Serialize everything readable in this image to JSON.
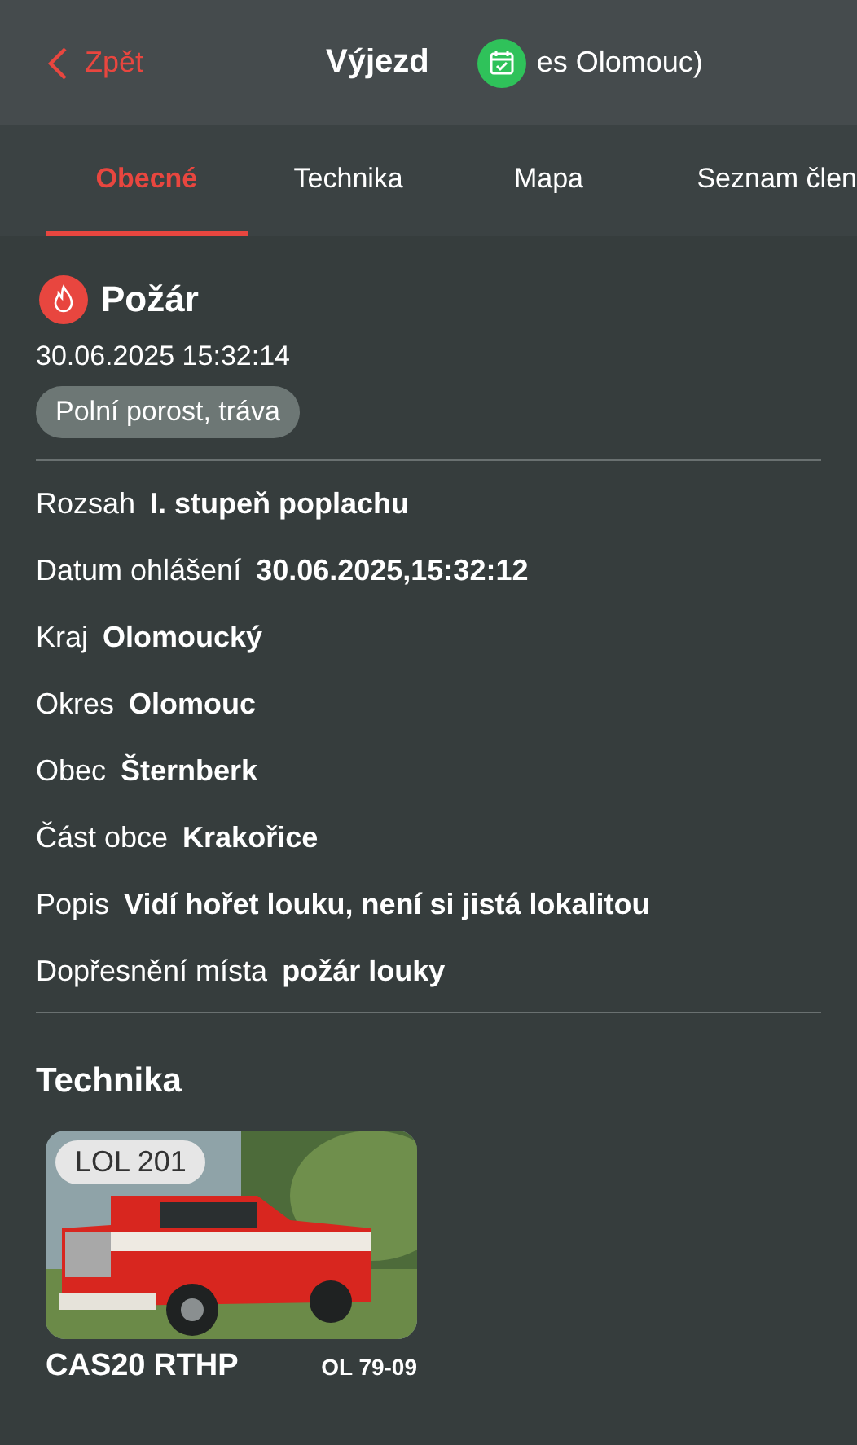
{
  "header": {
    "back": "Zpět",
    "title": "Výjezd",
    "subtitle": "es Olomouc)"
  },
  "tabs": [
    {
      "label": "Obecné",
      "selected": true
    },
    {
      "label": "Technika",
      "selected": false
    },
    {
      "label": "Mapa",
      "selected": false
    },
    {
      "label": "Seznam člen",
      "selected": false
    }
  ],
  "incident": {
    "type": "Požár",
    "datetime": "30.06.2025 15:32:14",
    "tag": "Polní porost, tráva"
  },
  "details": [
    {
      "label": "Rozsah",
      "value": "I. stupeň poplachu"
    },
    {
      "label": "Datum ohlášení",
      "value": "30.06.2025,15:32:12"
    },
    {
      "label": "Kraj",
      "value": "Olomoucký"
    },
    {
      "label": "Okres",
      "value": "Olomouc"
    },
    {
      "label": "Obec",
      "value": "Šternberk"
    },
    {
      "label": "Část obce",
      "value": "Krakořice"
    },
    {
      "label": "Popis",
      "value": "Vidí hořet louku, není si jistá lokalitou"
    },
    {
      "label": "Dopřesnění místa",
      "value": "požár louky"
    }
  ],
  "technika": {
    "heading": "Technika",
    "vehicles": [
      {
        "badge": "LOL 201",
        "name": "CAS20 RTHP",
        "plate": "OL 79-09"
      }
    ]
  }
}
